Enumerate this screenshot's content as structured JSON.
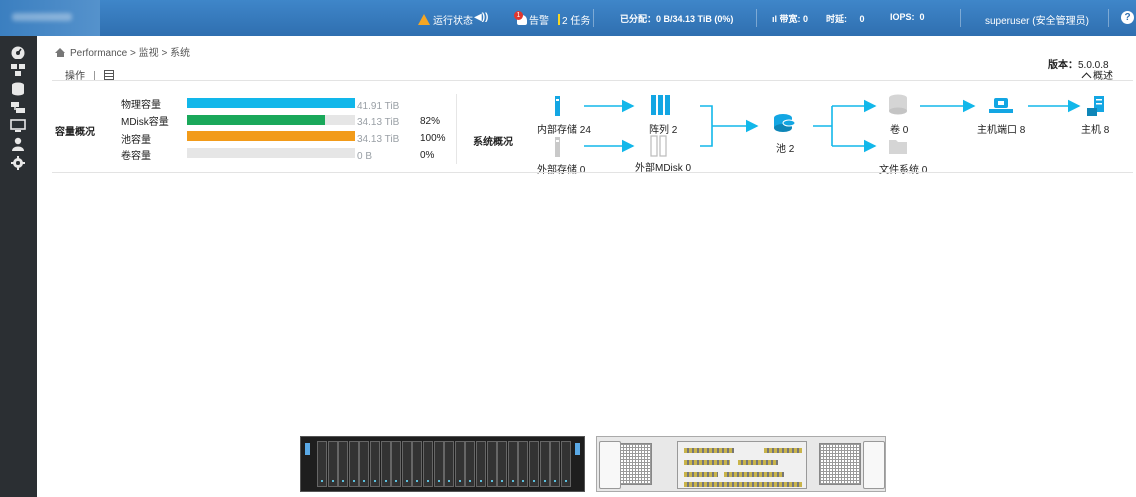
{
  "topbar": {
    "status_label": "运行状态",
    "alerts_count": "1",
    "alerts_label": "告警",
    "tasks_count": "2",
    "tasks_label": "任务",
    "allocated_text": "已分配：0 B/34.13 TiB (0%)",
    "bandwidth_label": "带宽: 0",
    "latency_label": "时延:",
    "latency_value": "0",
    "iops_label": "IOPS:",
    "iops_value": "0",
    "user": "superuser (安全管理员)",
    "help": "?"
  },
  "breadcrumb": {
    "root": "Performance",
    "level1": "监视",
    "level2": "系统",
    "separator": ">"
  },
  "version": {
    "label": "版本：",
    "value": "5.0.0.8"
  },
  "toolbar": {
    "actions_label": "操作",
    "overview_label": "概述"
  },
  "capacity": {
    "title": "容量概况",
    "rows": [
      {
        "label": "物理容量",
        "value": "41.91 TiB",
        "percent": "",
        "fill_fraction": 1.0,
        "color": "#12b7ea"
      },
      {
        "label": "MDisk容量",
        "value": "34.13 TiB",
        "percent": "82%",
        "fill_fraction": 0.82,
        "color": "#1aa85a"
      },
      {
        "label": "池容量",
        "value": "34.13 TiB",
        "percent": "100%",
        "fill_fraction": 1.0,
        "color": "#f29b1a"
      },
      {
        "label": "卷容量",
        "value": "0 B",
        "percent": "0%",
        "fill_fraction": 0.0,
        "color": "#e6e6e6"
      }
    ]
  },
  "system": {
    "title": "系统概况",
    "internal_storage": "内部存储 24",
    "external_storage": "外部存储 0",
    "arrays": "阵列 2",
    "external_mdisk": "外部MDisk 0",
    "pools": "池 2",
    "volumes": "卷 0",
    "file_systems": "文件系统 0",
    "host_ports": "主机端口 8",
    "hosts": "主机 8"
  },
  "colors": {
    "topbar": "#2f6fb0",
    "sidebar": "#2b2f33",
    "accent": "#12b7ea",
    "icon_blue": "#13a6e3"
  },
  "sidebar_icons": [
    "dashboard-icon",
    "monitoring-icon",
    "pools-icon",
    "volumes-icon",
    "hosts-icon",
    "access-icon",
    "settings-icon"
  ]
}
